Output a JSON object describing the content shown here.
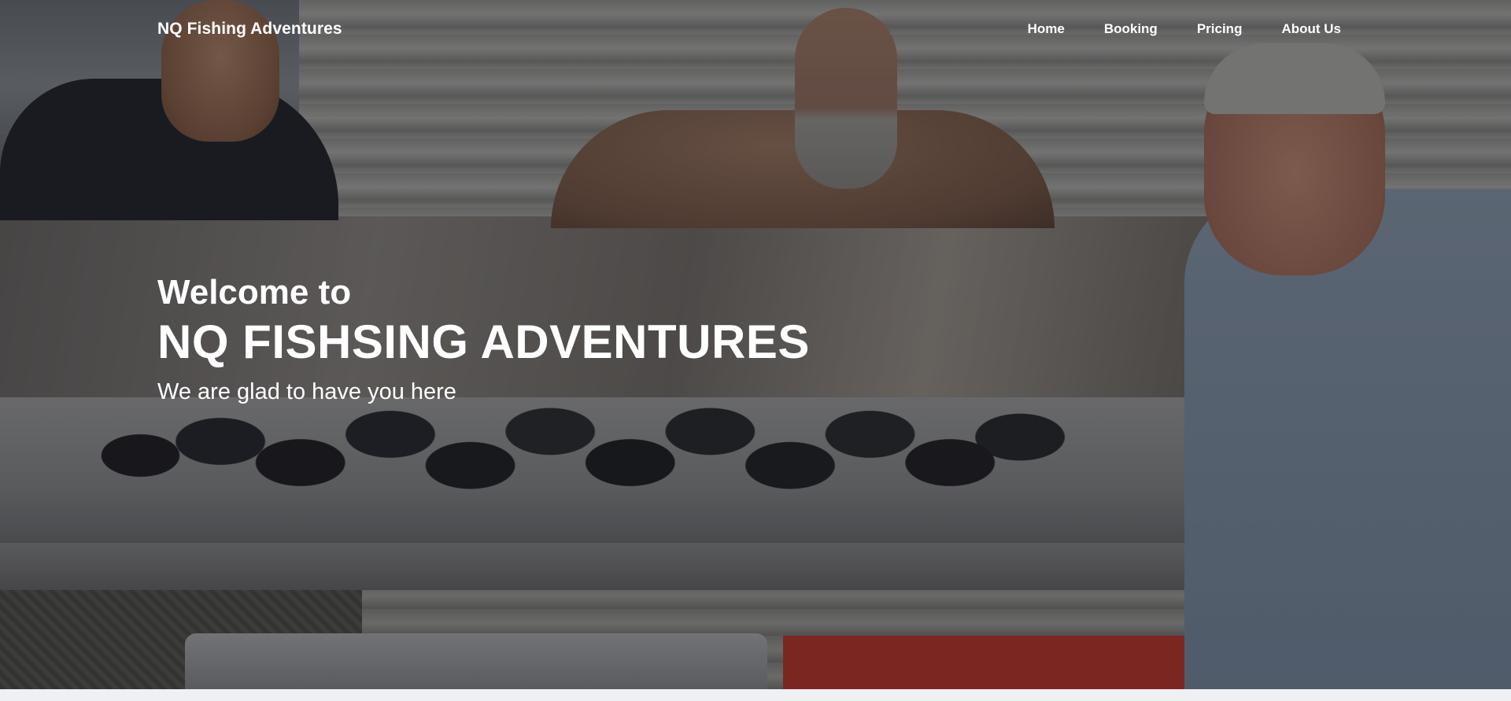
{
  "navbar": {
    "brand": "NQ Fishing Adventures",
    "links": [
      {
        "label": "Home"
      },
      {
        "label": "Booking"
      },
      {
        "label": "Pricing"
      },
      {
        "label": "About Us"
      }
    ]
  },
  "hero": {
    "welcome": "Welcome to",
    "title": "NQ FISHSING ADVENTURES",
    "tagline": "We are glad to have you here"
  }
}
